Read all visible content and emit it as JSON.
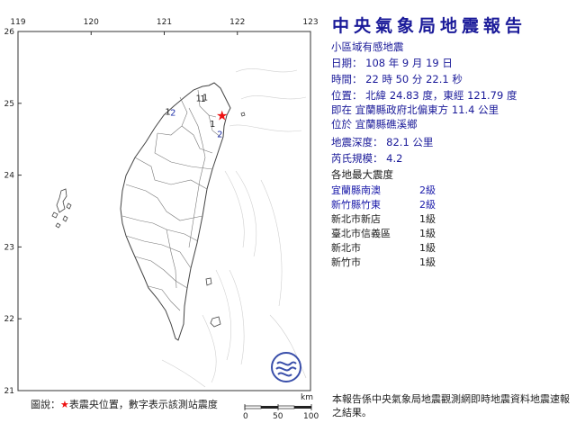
{
  "title": "中央氣象局地震報告",
  "subtitle": "小區域有感地震",
  "date": {
    "label": "日期：",
    "year": "108",
    "year_unit": "年",
    "month": "9",
    "month_unit": "月",
    "day": "19",
    "day_unit": "日"
  },
  "time": {
    "label": "時間：",
    "hour": "22",
    "hour_unit": "時",
    "minute": "50",
    "minute_unit": "分",
    "second": "22.1",
    "second_unit": "秒"
  },
  "position": {
    "label": "位置：",
    "lat_label": "北緯",
    "lat": "24.83",
    "lat_unit": "度",
    "lon_label": "東經",
    "lon": "121.79",
    "lon_unit": "度"
  },
  "relative_location": {
    "prefix": "即在",
    "text": "宜蘭縣政府北偏東方",
    "distance": "11.4",
    "unit": "公里"
  },
  "located_in": {
    "prefix": "位於",
    "text": "宜蘭縣礁溪鄉"
  },
  "depth": {
    "label": "地震深度：",
    "value": "82.1",
    "unit": "公里"
  },
  "magnitude": {
    "label": "芮氏規模：",
    "value": "4.2"
  },
  "intensity_header": "各地最大震度",
  "intensity": [
    {
      "site": "宜蘭縣南澳",
      "level": "2級",
      "highlight": true
    },
    {
      "site": "新竹縣竹東",
      "level": "2級",
      "highlight": true
    },
    {
      "site": "新北市新店",
      "level": "1級",
      "highlight": false
    },
    {
      "site": "臺北市信義區",
      "level": "1級",
      "highlight": false
    },
    {
      "site": "新北市",
      "level": "1級",
      "highlight": false
    },
    {
      "site": "新竹市",
      "level": "1級",
      "highlight": false
    }
  ],
  "footer": "本報告係中央氣象局地震觀測網即時地震資料地震速報之結果。",
  "legend": {
    "prefix": "圖說：",
    "star": "★",
    "text": "表震央位置，數字表示該測站震度"
  },
  "map": {
    "lon_ticks": [
      "119",
      "120",
      "121",
      "122",
      "123"
    ],
    "lat_ticks": [
      "26",
      "25",
      "24",
      "23",
      "22",
      "21"
    ],
    "epicenter": {
      "lon": 121.79,
      "lat": 24.83
    },
    "station_marks": [
      {
        "label": "1",
        "lon": 121.47,
        "lat": 25.03,
        "color": "#222222"
      },
      {
        "label": "1",
        "lon": 121.53,
        "lat": 25.02,
        "color": "#222222"
      },
      {
        "label": "1",
        "lon": 121.56,
        "lat": 25.04,
        "color": "#222222"
      },
      {
        "label": "1",
        "lon": 121.05,
        "lat": 24.84,
        "color": "#222222"
      },
      {
        "label": "2",
        "lon": 121.12,
        "lat": 24.83,
        "color": "#2233aa"
      },
      {
        "label": "1",
        "lon": 121.66,
        "lat": 24.67,
        "color": "#222222"
      },
      {
        "label": "2",
        "lon": 121.76,
        "lat": 24.53,
        "color": "#2233aa"
      }
    ],
    "scale": {
      "unit": "km",
      "ticks": [
        "0",
        "50",
        "100"
      ]
    },
    "colors": {
      "land": "#ffffff",
      "sea": "#ffffff",
      "border": "#555555",
      "frame": "#333333",
      "epicenter": "#ee1111",
      "logo": "#3a4faa"
    }
  }
}
